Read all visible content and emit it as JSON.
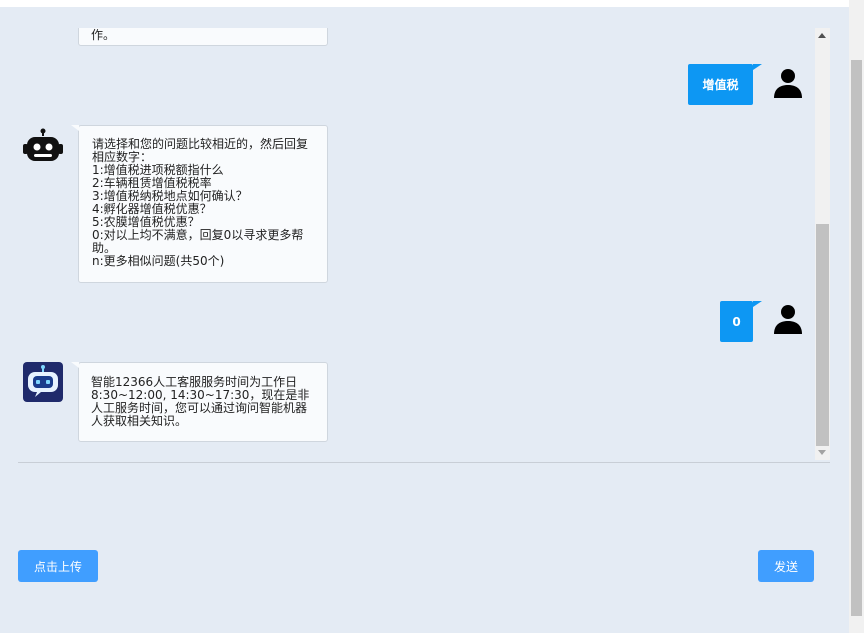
{
  "messages": {
    "partial_bot": {
      "text": "作。"
    },
    "user_1": {
      "text": "增值税"
    },
    "bot_menu": {
      "lines": [
        "请选择和您的问题比较相近的，然后回复相应数字：",
        "1:增值税进项税额指什么",
        "2:车辆租赁增值税税率",
        "3:增值税纳税地点如何确认？",
        "4:孵化器增值税优惠？",
        "5:农膜增值税优惠？",
        "0:对以上均不满意，回复0以寻求更多帮助。",
        "n:更多相似问题(共50个)"
      ]
    },
    "user_2": {
      "text": "0"
    },
    "bot_service": {
      "text": "智能12366人工客服服务时间为工作日8:30~12:00, 14:30~17:30，现在是非人工服务时间，您可以通过询问智能机器人获取相关知识。"
    }
  },
  "actions": {
    "upload_label": "点击上传",
    "send_label": "发送"
  },
  "colors": {
    "page_bg": "#e4ebf4",
    "user_bubble": "#0d97f3",
    "button": "#409eff"
  }
}
